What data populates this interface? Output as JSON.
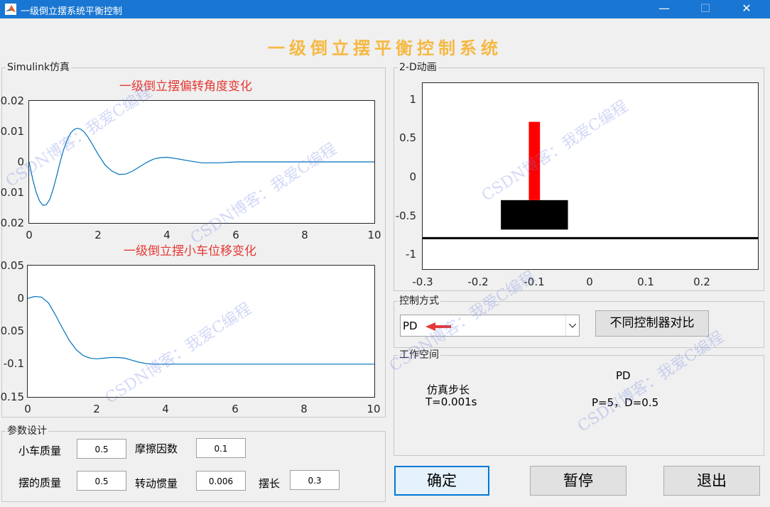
{
  "window": {
    "title": "一级倒立摆系统平衡控制",
    "minimize": "—",
    "maximize": "☐",
    "close": "✕"
  },
  "header": {
    "title": "一级倒立摆平衡控制系统"
  },
  "simulink": {
    "label": "Simulink仿真",
    "plot1": {
      "title": "一级倒立摆偏转角度变化",
      "yticks": [
        "0.02",
        "0.01",
        "0",
        "0.01",
        "0.02"
      ],
      "xticks": [
        "0",
        "2",
        "4",
        "6",
        "8",
        "10"
      ]
    },
    "plot2": {
      "title": "一级倒立摆小车位移变化",
      "yticks": [
        "0.05",
        "0",
        "0.05",
        "-0.1",
        "0.15"
      ],
      "xticks": [
        "0",
        "2",
        "4",
        "6",
        "8",
        "10"
      ]
    }
  },
  "chart_data": [
    {
      "type": "line",
      "title": "一级倒立摆偏转角度变化",
      "xlim": [
        0,
        10
      ],
      "ylim": [
        -0.02,
        0.02
      ],
      "color": "#0072bd",
      "x": [
        0,
        0.1,
        0.2,
        0.3,
        0.4,
        0.5,
        0.6,
        0.7,
        0.8,
        0.9,
        1.0,
        1.1,
        1.2,
        1.3,
        1.4,
        1.5,
        1.6,
        1.7,
        1.8,
        1.9,
        2.0,
        2.2,
        2.4,
        2.6,
        2.8,
        3.0,
        3.2,
        3.4,
        3.6,
        3.8,
        4.0,
        4.3,
        4.6,
        5.0,
        5.5,
        6.0,
        7.0,
        8.0,
        9.0,
        10.0
      ],
      "y": [
        0,
        -0.0055,
        -0.0098,
        -0.0128,
        -0.0142,
        -0.014,
        -0.0122,
        -0.0088,
        -0.0045,
        0.0,
        0.004,
        0.0072,
        0.0094,
        0.0106,
        0.011,
        0.0107,
        0.0097,
        0.0082,
        0.0064,
        0.0044,
        0.0025,
        -0.001,
        -0.003,
        -0.0041,
        -0.004,
        -0.003,
        -0.0016,
        -0.0002,
        0.0009,
        0.0014,
        0.0015,
        0.001,
        0.0004,
        -0.0003,
        -0.0003,
        0,
        0,
        0,
        0,
        0
      ]
    },
    {
      "type": "line",
      "title": "一级倒立摆小车位移变化",
      "xlim": [
        0,
        10
      ],
      "ylim": [
        -0.15,
        0.05
      ],
      "color": "#0072bd",
      "x": [
        0,
        0.2,
        0.4,
        0.6,
        0.8,
        1.0,
        1.2,
        1.4,
        1.6,
        1.8,
        2.0,
        2.2,
        2.4,
        2.6,
        2.8,
        3.0,
        3.2,
        3.4,
        3.6,
        3.8,
        4.0,
        4.5,
        5.0,
        6.0,
        7.0,
        8.0,
        9.0,
        10.0
      ],
      "y": [
        0,
        0.003,
        0.002,
        -0.007,
        -0.025,
        -0.045,
        -0.064,
        -0.078,
        -0.087,
        -0.091,
        -0.092,
        -0.091,
        -0.09,
        -0.09,
        -0.091,
        -0.094,
        -0.097,
        -0.099,
        -0.1,
        -0.1,
        -0.1,
        -0.1,
        -0.1,
        -0.1,
        -0.1,
        -0.1,
        -0.1,
        -0.1
      ]
    },
    {
      "type": "scatter",
      "title": "2-D动画",
      "xlim": [
        -0.3,
        0.3
      ],
      "ylim": [
        -1.2,
        1.2
      ],
      "ground_y": -0.8,
      "cart": {
        "x_from": -0.16,
        "x_to": -0.04,
        "y_from": -0.69,
        "y_to": -0.31
      },
      "pendulum": {
        "x_from": -0.11,
        "x_to": -0.09,
        "y_from": -0.31,
        "y_to": 0.7
      },
      "xticks": [
        "-0.3",
        "-0.2",
        "-0.1",
        "0",
        "0.1",
        "0.2"
      ],
      "yticks": [
        "1",
        "0.5",
        "0",
        "-0.5",
        "-1"
      ]
    }
  ],
  "params": {
    "label": "参数设计",
    "cart_mass_label": "小车质量",
    "cart_mass": "0.5",
    "friction_label": "摩擦因数",
    "friction": "0.1",
    "pend_mass_label": "摆的质量",
    "pend_mass": "0.5",
    "inertia_label": "转动惯量",
    "inertia": "0.006",
    "length_label": "摆长",
    "length": "0.3"
  },
  "animation": {
    "label": "2-D动画"
  },
  "control": {
    "label": "控制方式",
    "selected": "PD",
    "compare_button": "不同控制器对比"
  },
  "workspace": {
    "label": "工作空间",
    "method": "PD",
    "step_label": "仿真步长",
    "step_value": "T=0.001s",
    "gains": "P=5，D=0.5"
  },
  "buttons": {
    "ok": "确定",
    "pause": "暂停",
    "exit": "退出"
  },
  "watermark": "CSDN博客：我爱C编程",
  "colors": {
    "titlebar": "#1976d2",
    "header": "#f5b942",
    "plot_title": "#e53935",
    "line": "#0072bd",
    "pendulum": "#ff0000",
    "cart": "#000000"
  }
}
